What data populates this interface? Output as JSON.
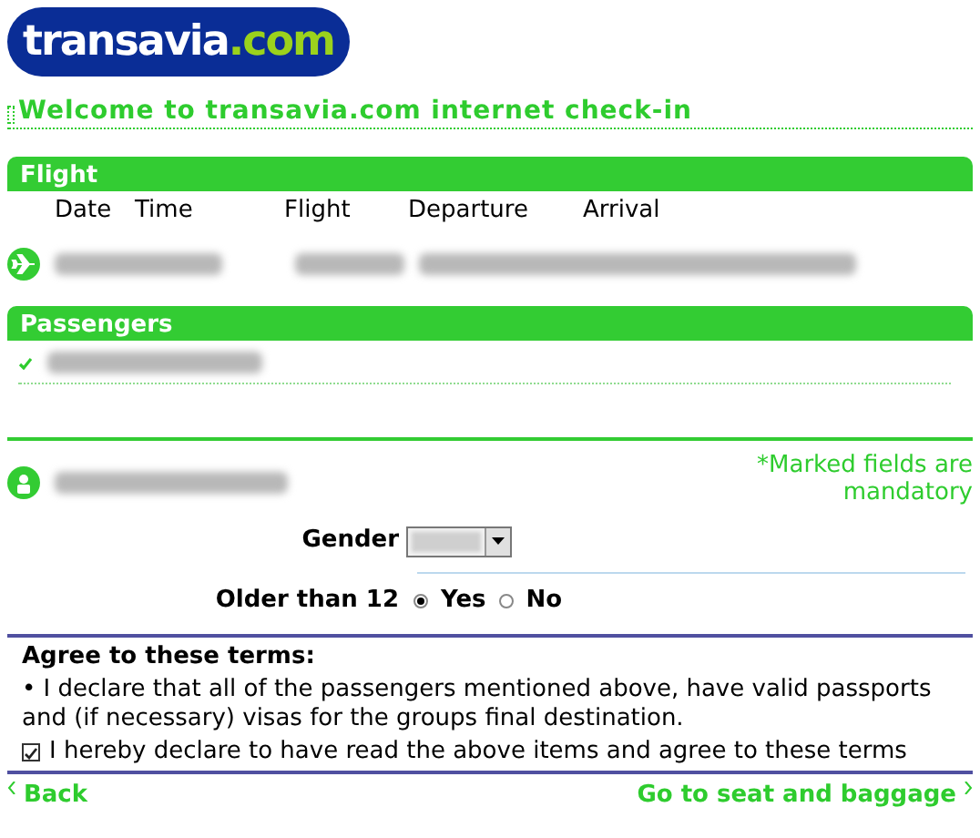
{
  "logo": {
    "name": "transavia",
    "suffix": ".com"
  },
  "title": "Welcome to transavia.com internet check-in",
  "flight": {
    "header": "Flight",
    "columns": [
      "Date",
      "Time",
      "Flight",
      "Departure",
      "Arrival"
    ]
  },
  "passengers": {
    "header": "Passengers",
    "items": [
      {
        "checked": true
      }
    ]
  },
  "mandatory_note": "*Marked fields are mandatory",
  "gender": {
    "label": "Gender"
  },
  "older_than_12": {
    "label": "Older than 12",
    "options": [
      {
        "label": "Yes",
        "selected": true
      },
      {
        "label": "No",
        "selected": false
      }
    ]
  },
  "terms": {
    "heading": "Agree to these terms:",
    "statement": "• I declare that all of the passengers mentioned above, have valid passports and (if necessary) visas for the groups final destination.",
    "agree": {
      "label": "I hereby declare to have read the above items and agree to these terms",
      "checked": true
    }
  },
  "nav": {
    "back": "Back",
    "next": "Go to seat and baggage"
  }
}
